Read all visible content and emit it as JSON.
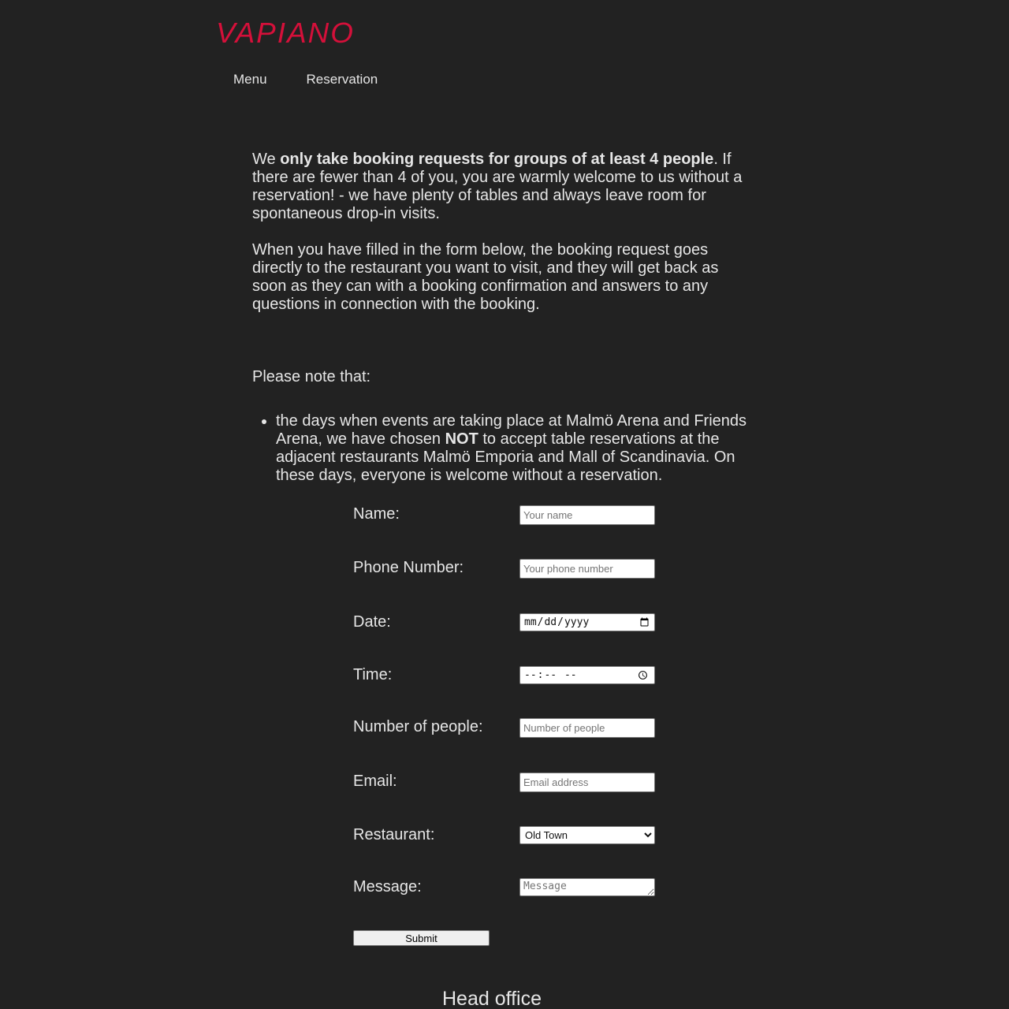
{
  "brand": {
    "logo_text": "VAPIANO",
    "logo_color": "#d4103a"
  },
  "nav": {
    "items": [
      {
        "label": "Menu"
      },
      {
        "label": "Reservation"
      }
    ]
  },
  "intro": {
    "p1_pre": "We ",
    "p1_bold": "only take booking requests for groups of at least 4 people",
    "p1_post": ". If there are fewer than 4 of you, you are warmly welcome to us without a reservation! - we have plenty of tables and always leave room for spontaneous drop-in visits.",
    "p2": "When you have filled in the form below, the booking request goes directly to the restaurant you want to visit, and they will get back as soon as they can with a booking confirmation and answers to any questions in connection with the booking.",
    "note_heading": "Please note that:",
    "bullet_pre": "the days when events are taking place at Malmö Arena and Friends Arena, we have chosen ",
    "bullet_bold": "NOT",
    "bullet_post": " to accept table reservations at the adjacent restaurants Malmö Emporia and Mall of Scandinavia. On these days, everyone is welcome without a reservation."
  },
  "form": {
    "name": {
      "label": "Name:",
      "placeholder": "Your name",
      "value": ""
    },
    "phone": {
      "label": "Phone Number:",
      "placeholder": "Your phone number",
      "value": ""
    },
    "date": {
      "label": "Date:",
      "placeholder": "mm/dd/yyyy",
      "value": ""
    },
    "time": {
      "label": "Time:",
      "placeholder": "--:-- --",
      "value": ""
    },
    "people": {
      "label": "Number of people:",
      "placeholder": "Number of people",
      "value": ""
    },
    "email": {
      "label": "Email:",
      "placeholder": "Email address",
      "value": ""
    },
    "restaurant": {
      "label": "Restaurant:",
      "selected": "Old Town"
    },
    "message": {
      "label": "Message:",
      "placeholder": "Message",
      "value": ""
    },
    "submit_label": "Submit"
  },
  "footer": {
    "title": "Head office"
  }
}
